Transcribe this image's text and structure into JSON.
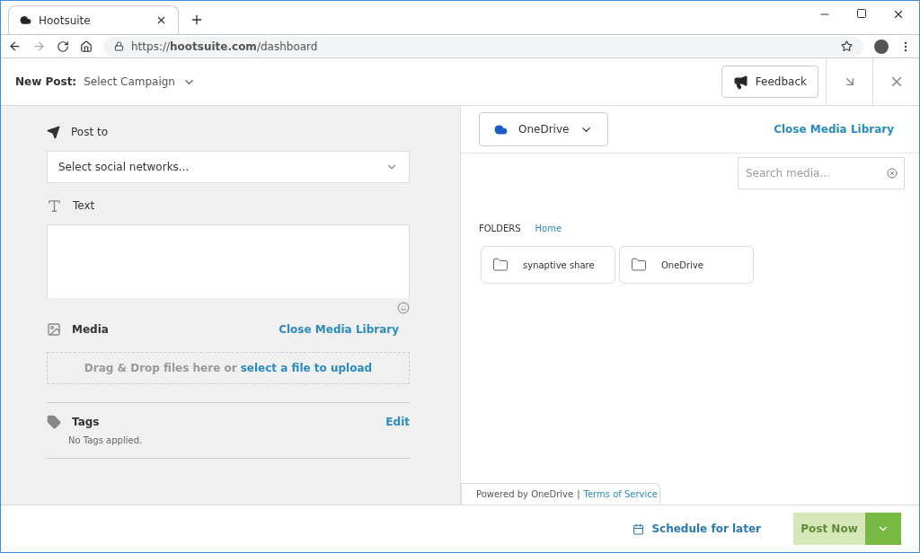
{
  "browser": {
    "tab_title": "Hootsuite",
    "url": "https://**hootsuite.com**/dashboard"
  },
  "header": {
    "label": "New Post:",
    "campaign": "Select Campaign",
    "feedback": "Feedback"
  },
  "composer": {
    "post_to": {
      "label": "Post to",
      "placeholder": "Select social networks..."
    },
    "text": {
      "label": "Text"
    },
    "media": {
      "label": "Media",
      "link": "Close Media Library",
      "drop_text": "Drag & Drop files here or",
      "drop_link": "select a file to upload"
    },
    "tags": {
      "label": "Tags",
      "edit": "Edit",
      "empty": "No Tags applied."
    }
  },
  "library": {
    "source": "OneDrive",
    "close": "Close Media Library",
    "search_placeholder": "Search media...",
    "folders_label": "FOLDERS",
    "breadcrumb": "Home",
    "folders": [
      {
        "name": "synaptive share"
      },
      {
        "name": "OneDrive"
      }
    ],
    "powered_by": "Powered by OneDrive",
    "separator": "|",
    "terms": "Terms of Service"
  },
  "footer": {
    "schedule": "Schedule for later",
    "post_now": "Post Now",
    "disabled": true
  }
}
